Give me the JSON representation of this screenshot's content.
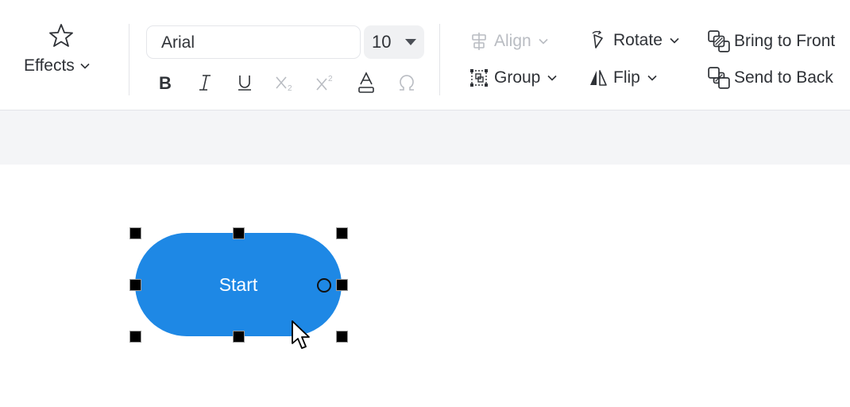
{
  "toolbar": {
    "effects_label": "Effects",
    "font_family": "Arial",
    "font_size": "10",
    "format_buttons": [
      "bold-icon",
      "italic-icon",
      "underline-icon",
      "subscript-icon",
      "superscript-icon",
      "font-color-icon",
      "special-character-icon"
    ],
    "align_label": "Align",
    "group_label": "Group",
    "rotate_label": "Rotate",
    "flip_label": "Flip",
    "bring_front_label": "Bring to Front",
    "send_back_label": "Send to Back"
  },
  "canvas": {
    "shape_label": "Start",
    "shape_color": "#1e88e5",
    "shape_type": "terminator",
    "selected": true
  }
}
